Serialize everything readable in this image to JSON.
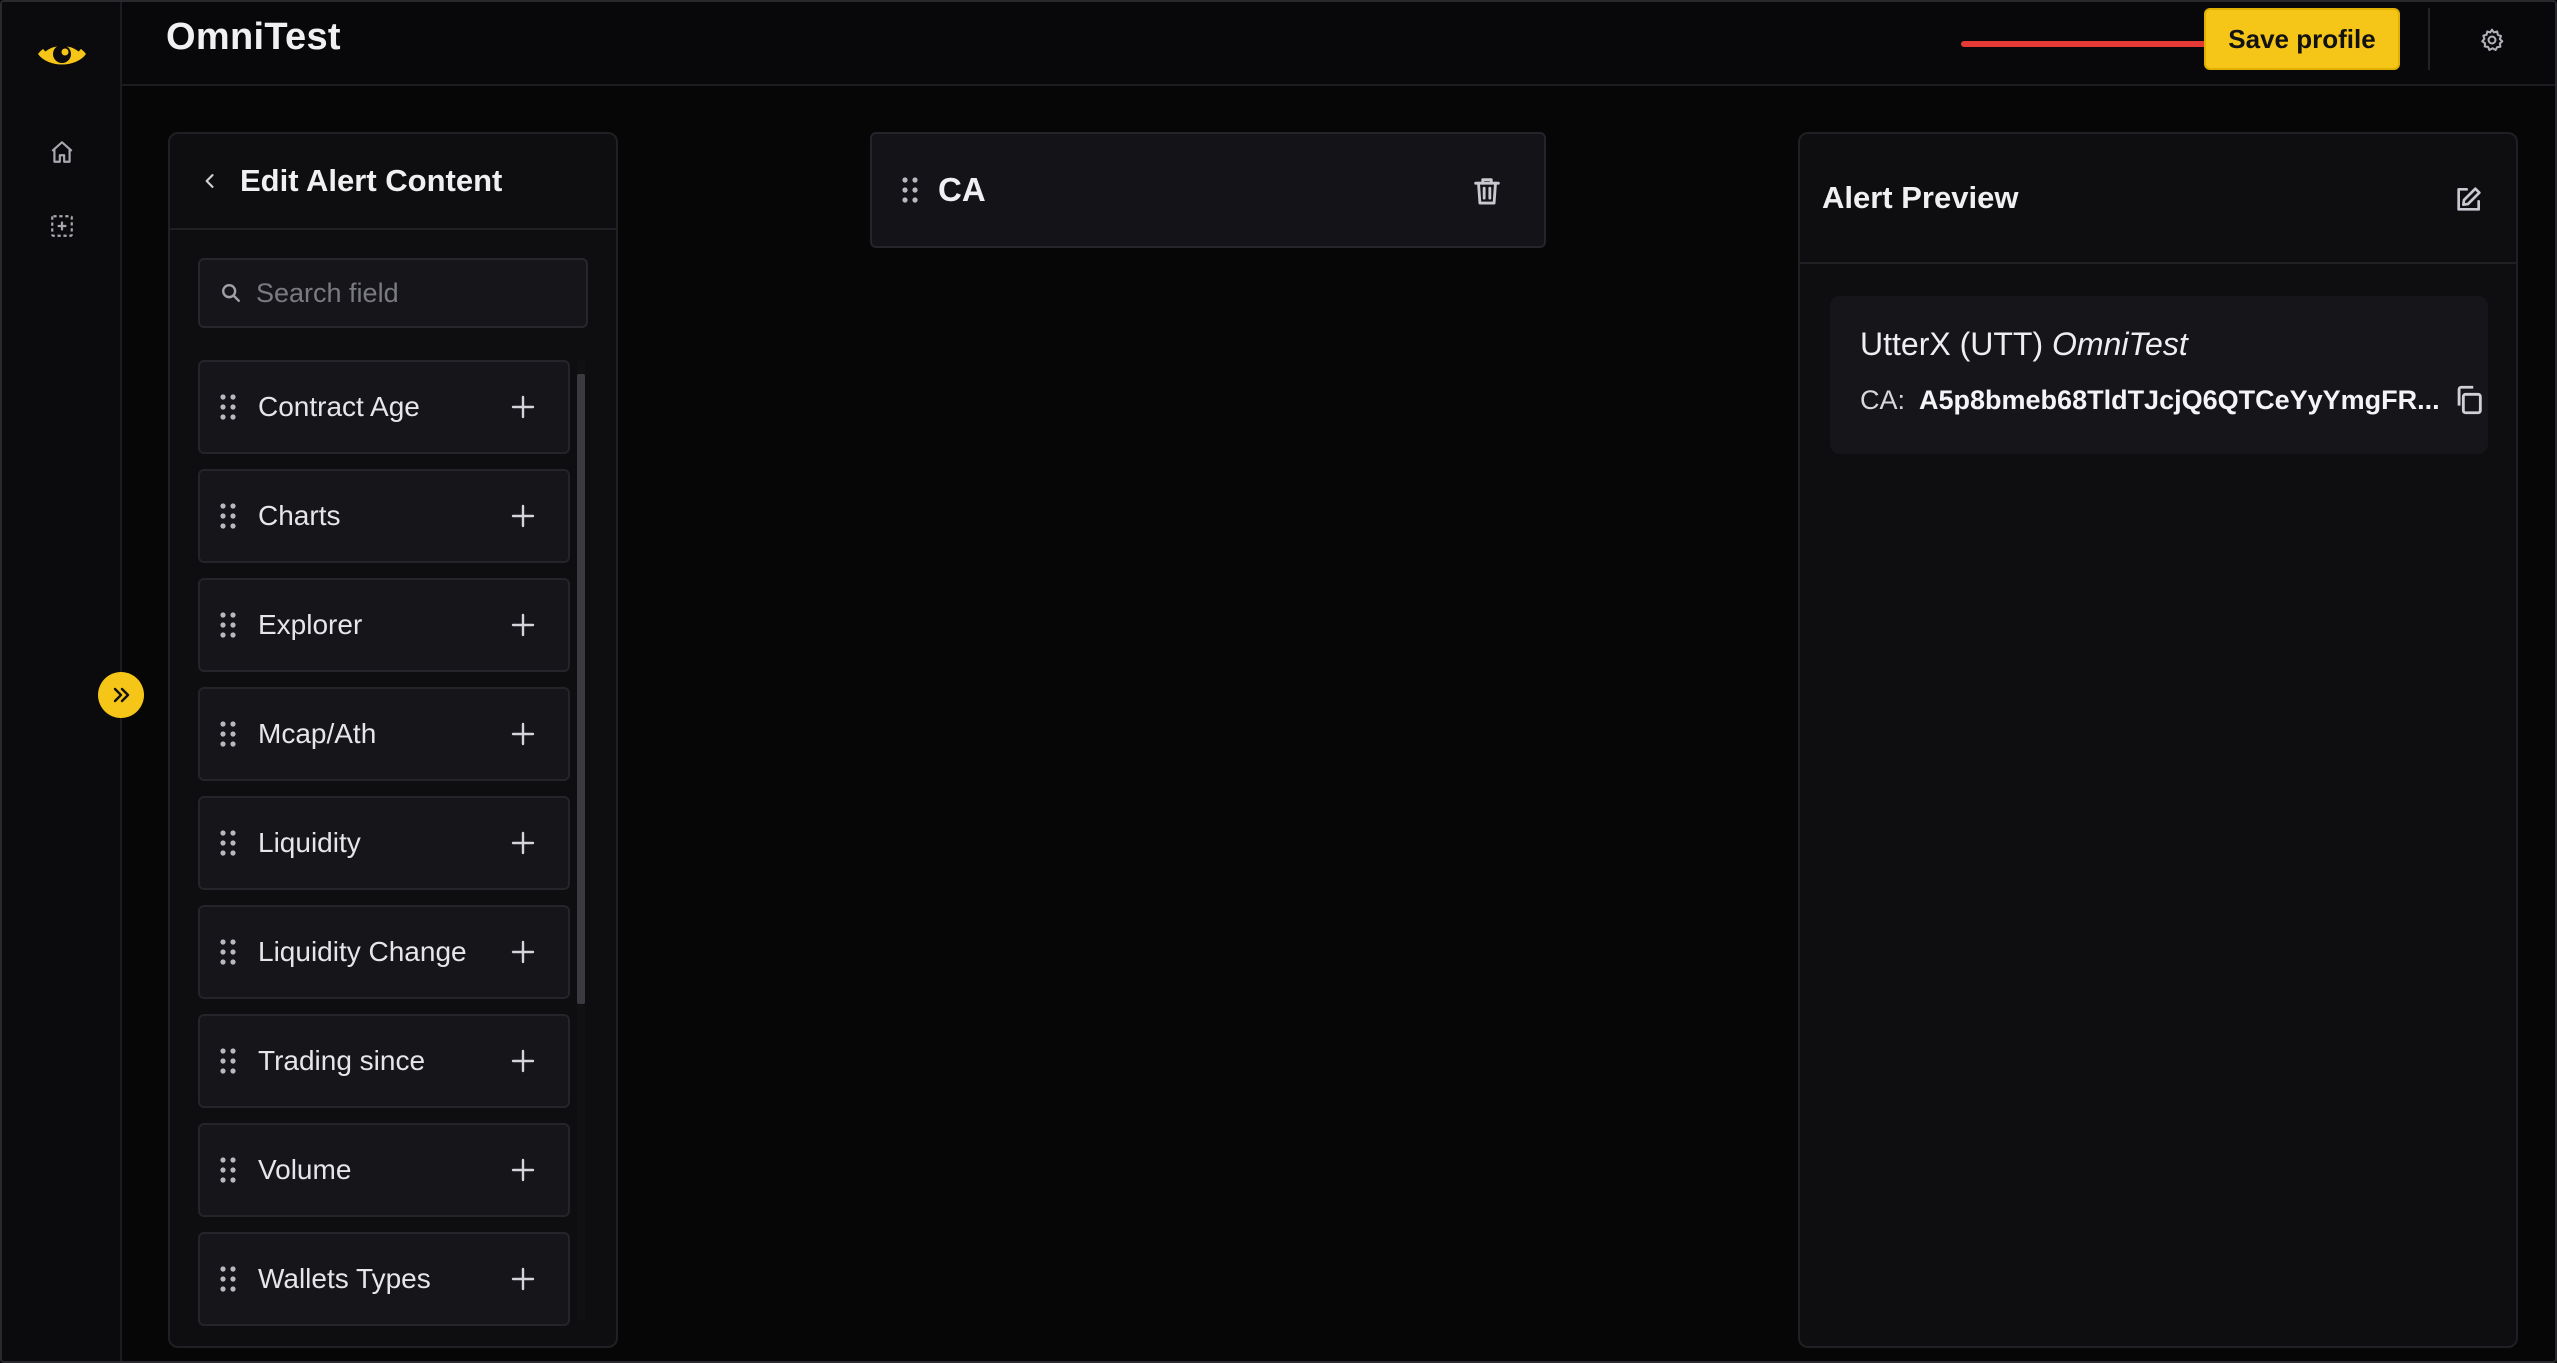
{
  "header": {
    "app_title": "OmniTest",
    "save_label": "Save profile"
  },
  "left_panel": {
    "title": "Edit Alert Content",
    "search_placeholder": "Search field",
    "fields": [
      {
        "label": "Contract Age"
      },
      {
        "label": "Charts"
      },
      {
        "label": "Explorer"
      },
      {
        "label": "Mcap/Ath"
      },
      {
        "label": "Liquidity"
      },
      {
        "label": "Liquidity Change"
      },
      {
        "label": "Trading since"
      },
      {
        "label": "Volume"
      },
      {
        "label": "Wallets Types"
      }
    ]
  },
  "content": {
    "selected_field": "CA"
  },
  "preview": {
    "title": "Alert Preview",
    "token_name": "UtterX (UTT)",
    "profile_name": "OmniTest",
    "ca_label": "CA:",
    "ca_value": "A5p8bmeb68TldTJcjQ6QTCeYyYmgFR..."
  },
  "icons": {
    "logo": "omnitest-eye-logo",
    "nav": [
      "home-icon",
      "grid-add-icon"
    ],
    "expand": "double-chevron-right-icon",
    "settings": "gear-icon",
    "arrow": "red-arrow-annotation"
  },
  "colors": {
    "accent": "#f5c518",
    "annotation_arrow": "#e53935",
    "background": "#060607",
    "panel": "#0e0e11"
  }
}
